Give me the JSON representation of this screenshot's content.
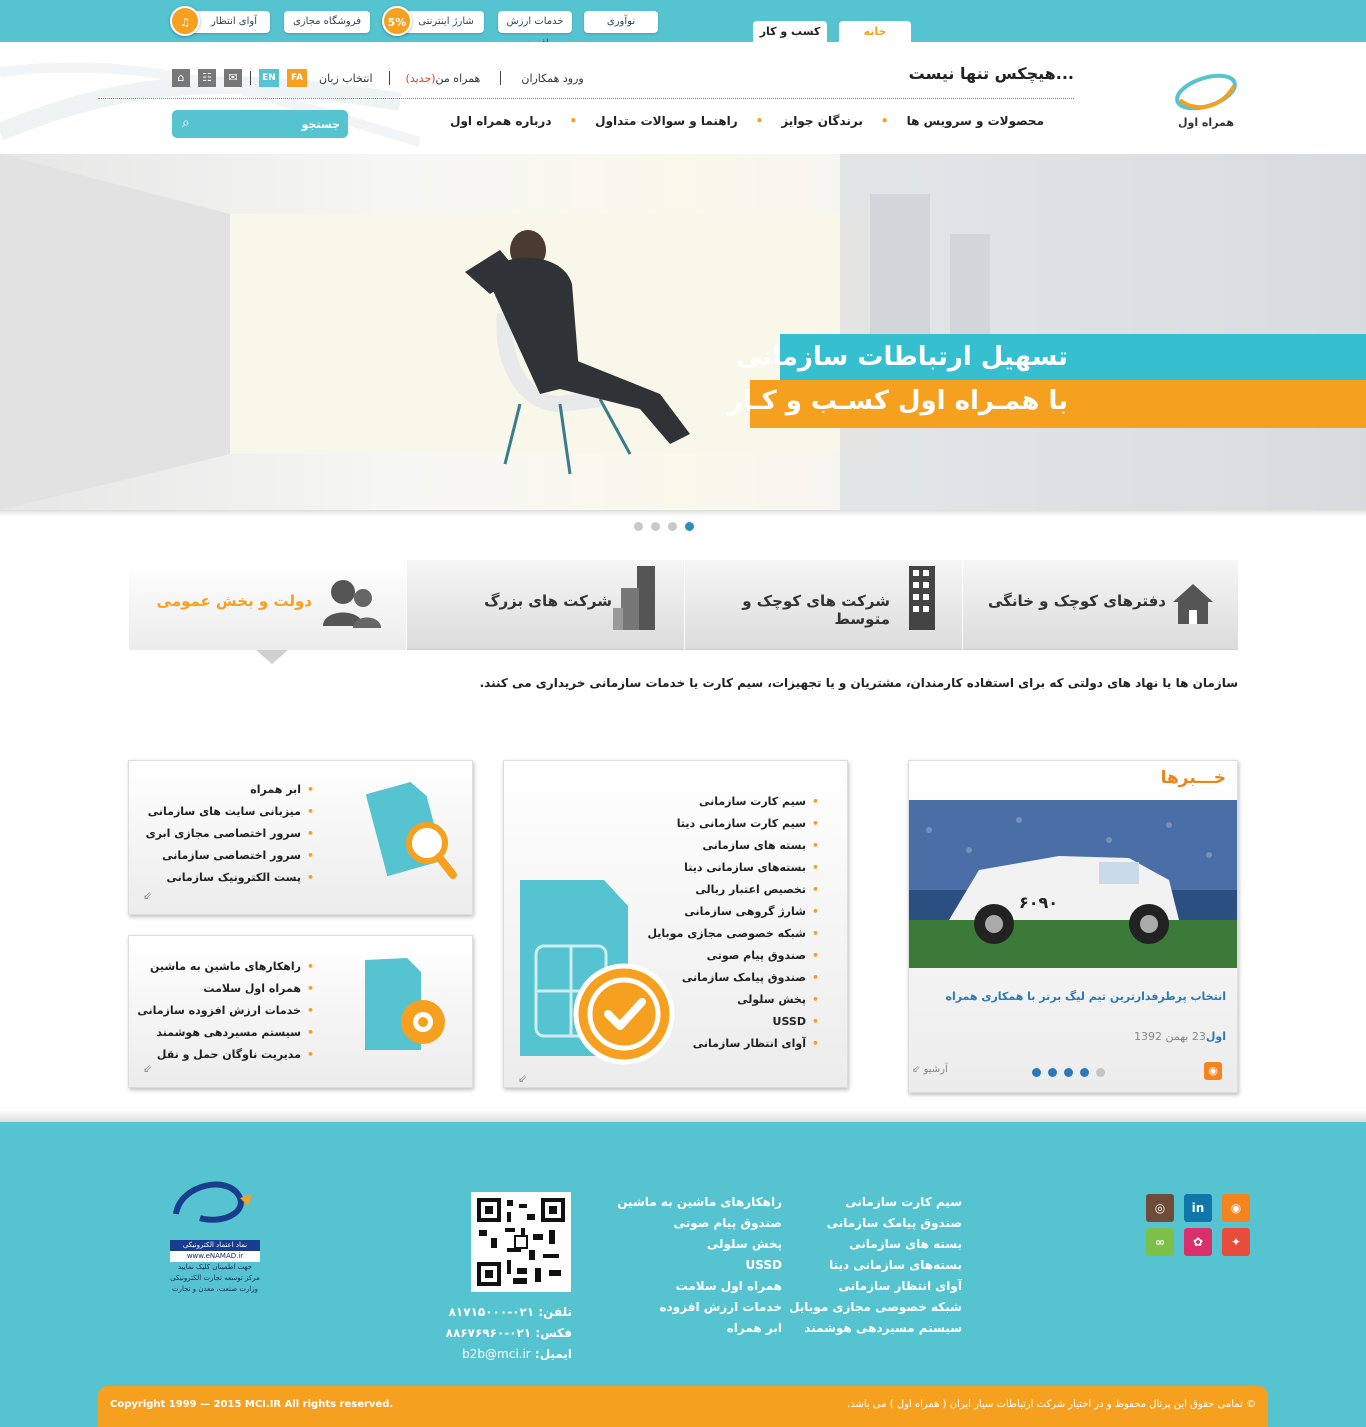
{
  "topbar": {
    "tab_home": "خانه",
    "tab_business": "کسب و کار",
    "links": [
      "نوآوری",
      "خدمات ارزش افزوده",
      "شارژ اینترنتی",
      "فروشگاه مجازی",
      "آوای انتظار"
    ],
    "charge_badge": "5%"
  },
  "header": {
    "slogan": "هیچکس تنها نیست...",
    "login": "ورود همکاران",
    "my_hamrah": "همراه من",
    "new_tag": "(جدید)",
    "lang_label": "انتخاب زبان",
    "lang_fa": "FA",
    "lang_en": "EN",
    "search_placeholder": "جستجو",
    "nav": [
      "محصولات و سرویس ها",
      "برندگان جوایز",
      "راهنما و سوالات متداول",
      "درباره همراه اول"
    ],
    "logo_text": "همراه اول"
  },
  "banner": {
    "line1": "تسهیل ارتباطات سازمانی",
    "line2": "با همـراه اول کسـب و کـار",
    "slide_count": 4,
    "active_slide": 4
  },
  "segments": {
    "items": [
      "دفترهای کوچک و خانگی",
      "شرکت های کوچک و متوسط",
      "شرکت های بزرگ",
      "دولت و بخش عمومی"
    ],
    "active": "دولت و بخش عمومی",
    "description": "سازمان ها یا نهاد های دولتی که برای استفاده کارمندان، مشتریان و یا تجهیزات، سیم کارت یا خدمات سازمانی خریداری می کنند."
  },
  "box_cloud": {
    "items": [
      "ابر همراه",
      "میزبانی سایت های سازمانی",
      "سرور اختصاصی مجازی ابری",
      "سرور اختصاصی سازمانی",
      "پست الکترونیک سازمانی"
    ]
  },
  "box_m2m": {
    "items": [
      "راهکارهای ماشین به ماشین",
      "همراه اول سلامت",
      "خدمات ارزش افزوده سازمانی",
      "سیستم مسیردهی هوشمند",
      "مدیریت ناوگان حمل و نقل"
    ]
  },
  "box_sim": {
    "items": [
      "سیم کارت سازمانی",
      "سیم کارت سازمانی دیتا",
      "بسته های سازمانی",
      "بسته‌های سازمانی دیتا",
      "تخصیص اعتبار ریالی",
      "شارژ گروهی سازمانی",
      "شبکه خصوصی مجازی موبایل",
      "صندوق پیام صوتی",
      "صندوق پیامک سازمانی",
      "پخش سلولی",
      "USSD",
      "آوای انتظار سازمانی"
    ]
  },
  "news": {
    "title": "خـــبرها",
    "headline": "انتخاب پرطرفدارترین تیم لیگ برتر با همکاری همراه",
    "headline_tail": "اول",
    "date": "23 بهمن 1392",
    "archive": "آرشیو",
    "dot_count": 5,
    "active_dot": 5
  },
  "footer": {
    "col1": [
      "سیم کارت سازمانی",
      "صندوق پیامک سازمانی",
      "بسته های سازمانی",
      "بسته‌های سازمانی دیتا",
      "آوای انتظار سازمانی",
      "شبکه خصوصی مجازی موبایل",
      "سیستم مسیردهی هوشمند"
    ],
    "col2": [
      "راهکارهای ماشین به ماشین",
      "صندوق پیام صوتی",
      "پخش سلولی",
      "USSD",
      "همراه اول سلامت",
      "خدمات ارزش افزوده",
      "ابر همراه"
    ],
    "phone_label": "تلفن:",
    "phone": "۰۲۱-۸۱۷۱۵۰۰۰",
    "fax_label": "فکس:",
    "fax": "۰۲۱-۸۸۶۷۶۹۶۰",
    "email_label": "ایمیل:",
    "email": "b2b@mci.ir",
    "enamad_lines": [
      "نماد اعتماد الکترونیکی",
      "www.eNAMAD.ir",
      "جهت اطمینان کلیک نمایید",
      "مرکز توسعه تجارت الکترونیکی",
      "وزارت صنعت، معدن و تجارت"
    ],
    "copyright_left": "Copyright 1999 — 2015 MCI.IR All rights reserved.",
    "copyright_right": "© تمامی حقوق این پرتال محفوظ و در اختیار شرکت ارتباطات سیار ایران ( همراه اول ) می باشد."
  },
  "colors": {
    "teal": "#56c3d1",
    "orange": "#f5a11f",
    "link_blue": "#2a7ab5"
  }
}
